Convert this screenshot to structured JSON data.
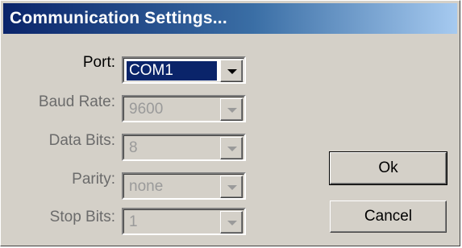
{
  "window": {
    "title": "Communication Settings..."
  },
  "fields": [
    {
      "label": "Port:",
      "value": "COM1",
      "enabled": true
    },
    {
      "label": "Baud Rate:",
      "value": "9600",
      "enabled": false
    },
    {
      "label": "Data Bits:",
      "value": "8",
      "enabled": false
    },
    {
      "label": "Parity:",
      "value": "none",
      "enabled": false
    },
    {
      "label": "Stop Bits:",
      "value": "1",
      "enabled": false
    }
  ],
  "buttons": {
    "ok": "Ok",
    "cancel": "Cancel"
  },
  "icons": {
    "dropdown": "chevron-down-icon"
  },
  "colors": {
    "titlebar_start": "#0a246a",
    "titlebar_end": "#a6caf0",
    "selection": "#0a246a",
    "face": "#d4d0c8"
  }
}
